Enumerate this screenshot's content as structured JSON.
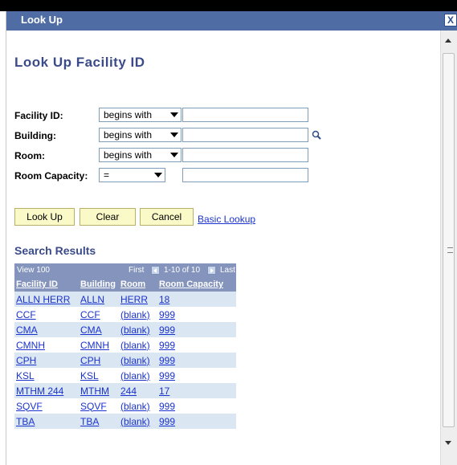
{
  "window": {
    "title": "Look Up",
    "close_label": "X"
  },
  "page_title": "Look Up Facility ID",
  "fields": [
    {
      "label": "Facility ID:",
      "operator": "begins with",
      "value": ""
    },
    {
      "label": "Building:",
      "operator": "begins with",
      "value": ""
    },
    {
      "label": "Room:",
      "operator": "begins with",
      "value": ""
    },
    {
      "label": "Room Capacity:",
      "operator": "=",
      "value": ""
    }
  ],
  "buttons": {
    "lookup": "Look Up",
    "clear": "Clear",
    "cancel": "Cancel"
  },
  "basic_lookup_link": "Basic Lookup",
  "results": {
    "heading": "Search Results",
    "view_label": "View 100",
    "first_label": "First",
    "range_label": "1-10 of 10",
    "last_label": "Last",
    "columns": [
      "Facility ID",
      "Building",
      "Room",
      "Room Capacity"
    ],
    "rows": [
      [
        "ALLN HERR",
        "ALLN",
        "HERR",
        "18"
      ],
      [
        "CCF",
        "CCF",
        "(blank)",
        "999"
      ],
      [
        "CMA",
        "CMA",
        "(blank)",
        "999"
      ],
      [
        "CMNH",
        "CMNH",
        "(blank)",
        "999"
      ],
      [
        "CPH",
        "CPH",
        "(blank)",
        "999"
      ],
      [
        "KSL",
        "KSL",
        "(blank)",
        "999"
      ],
      [
        "MTHM 244",
        "MTHM",
        "244",
        "17"
      ],
      [
        "SQVF",
        "SQVF",
        "(blank)",
        "999"
      ],
      [
        "TBA",
        "TBA",
        "(blank)",
        "999"
      ]
    ]
  },
  "colors": {
    "titlebar": "#4f6da4",
    "heading": "#3b4b8a",
    "grid_header": "#8494bc",
    "button_bg": "#fafac8",
    "link": "#1a33cc"
  }
}
